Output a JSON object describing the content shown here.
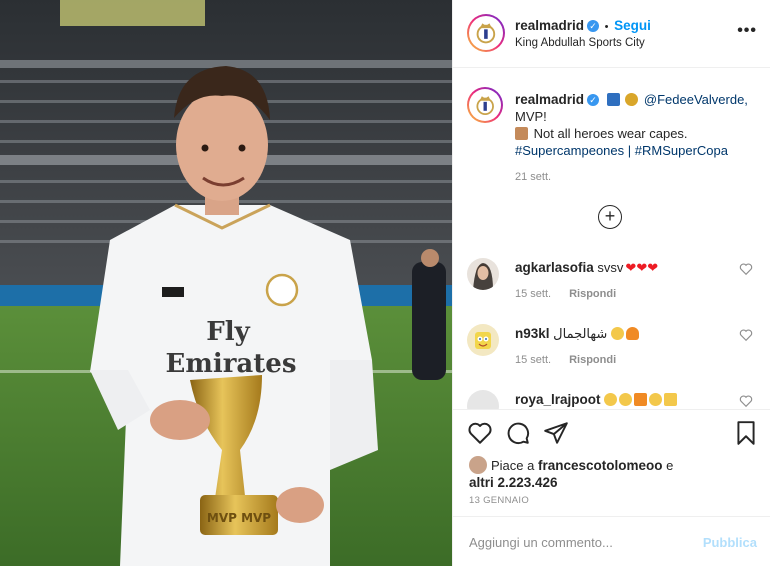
{
  "header": {
    "username": "realmadrid",
    "verified": "✓",
    "separator": "•",
    "follow_label": "Segui",
    "location": "King Abdullah Sports City",
    "more_label": "•••"
  },
  "caption": {
    "username": "realmadrid",
    "mention": "@FedeeValverde,",
    "line2": "MVP!",
    "line3": "Not all heroes wear capes.",
    "hashtag1": "#Supercampeones",
    "divider": "|",
    "hashtag2": "#RMSuperCopa",
    "time": "21 sett."
  },
  "load_more_label": "+",
  "comments": [
    {
      "username": "agkarlasofia",
      "text": "svsv",
      "hearts": "❤❤❤",
      "time": "15 sett.",
      "reply": "Rispondi"
    },
    {
      "username": "n93kl",
      "text": "شهالجمال",
      "time": "15 sett.",
      "reply": "Rispondi"
    },
    {
      "username": "roya_lrajpoot"
    }
  ],
  "likes": {
    "prefix": "Piace a",
    "user": "francescotolomeoo",
    "suffix": "e",
    "others": "altri 2.223.426"
  },
  "date": "13 GENNAIO",
  "add_comment": {
    "placeholder": "Aggiungi un commento...",
    "publish": "Pubblica"
  },
  "photo": {
    "shirt_sponsor_line1": "Fly",
    "shirt_sponsor_line2": "Emirates",
    "trophy_label": "MVP MVP"
  },
  "colors": {
    "accent": "#0095f6",
    "verified": "#3897f0",
    "heart": "#ed1c24",
    "muted": "#8e8e8e"
  },
  "icons": [
    "heart-icon",
    "comment-icon",
    "share-icon",
    "bookmark-icon",
    "more-icon",
    "plus-circle-icon"
  ]
}
